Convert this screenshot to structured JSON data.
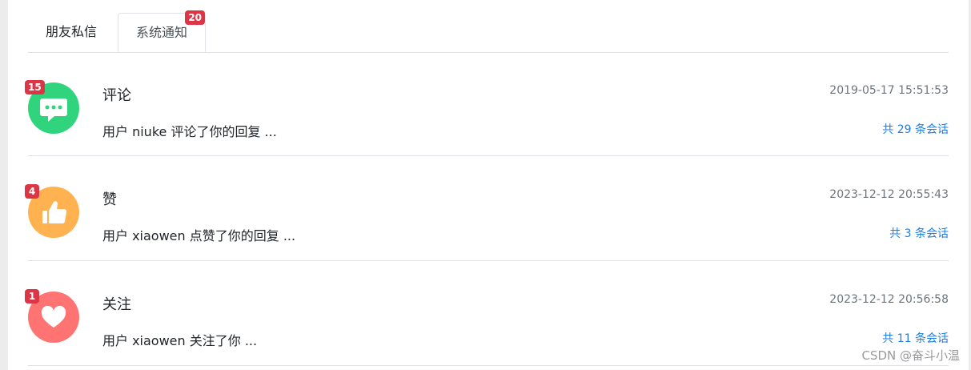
{
  "tabs": {
    "friends_label": "朋友私信",
    "system_label": "系统通知",
    "system_badge": "20"
  },
  "notices": [
    {
      "title": "评论",
      "badge": "15",
      "content": "用户 niuke 评论了你的回复 ...",
      "time": "2019-05-17 15:51:53",
      "total": "共 29 条会话",
      "icon": "comment-icon",
      "color": "#2fd47c"
    },
    {
      "title": "赞",
      "badge": "4",
      "content": "用户 xiaowen 点赞了你的回复 ...",
      "time": "2023-12-12 20:55:43",
      "total": "共 3 条会话",
      "icon": "thumbs-up-icon",
      "color": "#ffb24f"
    },
    {
      "title": "关注",
      "badge": "1",
      "content": "用户 xiaowen 关注了你 ...",
      "time": "2023-12-12 20:56:58",
      "total": "共 11 条会话",
      "icon": "heart-icon",
      "color": "#ff7472"
    }
  ],
  "watermark": "CSDN @奋斗小温",
  "colors": {
    "badge": "#dc3545",
    "link": "#1e7ee8",
    "muted": "#6c757d"
  }
}
